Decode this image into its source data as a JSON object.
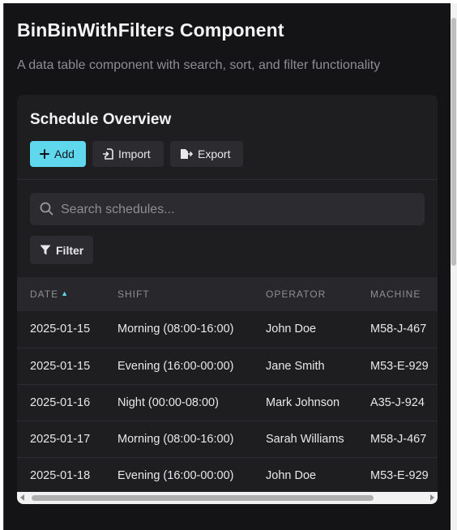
{
  "page": {
    "title": "BinBinWithFilters Component",
    "subtitle": "A data table component with search, sort, and filter functionality"
  },
  "card": {
    "title": "Schedule Overview",
    "actions": [
      {
        "label": "Add",
        "icon": "plus-icon"
      },
      {
        "label": "Import",
        "icon": "import-icon"
      },
      {
        "label": "Export",
        "icon": "export-icon"
      }
    ],
    "search": {
      "placeholder": "Search schedules...",
      "value": ""
    },
    "filter": {
      "label": "Filter",
      "icon": "filter-icon"
    }
  },
  "table": {
    "columns": [
      {
        "label": "DATE",
        "sorted": "asc"
      },
      {
        "label": "SHIFT"
      },
      {
        "label": "OPERATOR"
      },
      {
        "label": "MACHINE"
      }
    ],
    "rows": [
      [
        "2025-01-15",
        "Morning (08:00-16:00)",
        "John Doe",
        "M58-J-467"
      ],
      [
        "2025-01-15",
        "Evening (16:00-00:00)",
        "Jane Smith",
        "M53-E-929"
      ],
      [
        "2025-01-16",
        "Night (00:00-08:00)",
        "Mark Johnson",
        "A35-J-924"
      ],
      [
        "2025-01-17",
        "Morning (08:00-16:00)",
        "Sarah Williams",
        "M58-J-467"
      ],
      [
        "2025-01-18",
        "Evening (16:00-00:00)",
        "John Doe",
        "M53-E-929"
      ]
    ]
  },
  "colors": {
    "accent": "#5fd8ee",
    "background": "#141416",
    "card": "#1e1e21"
  }
}
